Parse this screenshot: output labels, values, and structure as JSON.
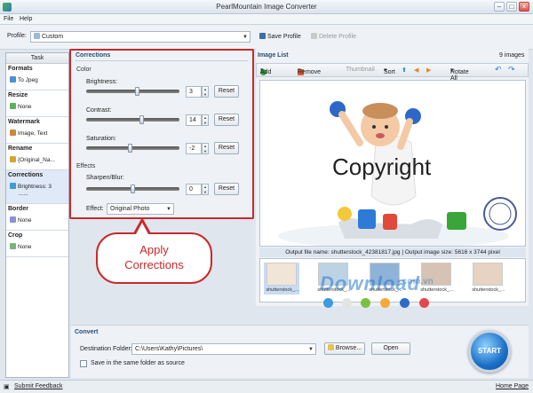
{
  "window": {
    "title": "PearlMountain Image Converter"
  },
  "menu": {
    "file": "File",
    "help": "Help"
  },
  "profile": {
    "label": "Profile:",
    "value": "Custom",
    "save": "Save Profile",
    "delete": "Delete Profile"
  },
  "task": {
    "header": "Task",
    "sections": [
      {
        "title": "Formats",
        "value": "To Jpeg"
      },
      {
        "title": "Resize",
        "value": "None"
      },
      {
        "title": "Watermark",
        "value": "Image, Text"
      },
      {
        "title": "Rename",
        "value": "{Original_Na..."
      },
      {
        "title": "Corrections",
        "value": "Brightness: 3",
        "value2": "......"
      },
      {
        "title": "Border",
        "value": "None"
      },
      {
        "title": "Crop",
        "value": "None"
      }
    ]
  },
  "corrections": {
    "header": "Corrections",
    "color_group": "Color",
    "brightness": {
      "label": "Brightness:",
      "value": "3",
      "reset": "Reset",
      "level": 0.55
    },
    "contrast": {
      "label": "Contrast:",
      "value": "14",
      "reset": "Reset",
      "level": 0.6
    },
    "saturation": {
      "label": "Saturation:",
      "value": "-2",
      "reset": "Reset",
      "level": 0.48
    },
    "effects_group": "Effects",
    "sharpen": {
      "label": "Sharpen/Blur:",
      "value": "0",
      "reset": "Reset",
      "level": 0.5
    },
    "effect": {
      "label": "Effect:",
      "value": "Original Photo"
    }
  },
  "callout": {
    "line1": "Apply",
    "line2": "Corrections"
  },
  "image_list": {
    "header": "Image List",
    "count": "9 images",
    "toolbar": {
      "add": "Add",
      "remove": "Remove",
      "thumbnail": "Thumbnail",
      "sort": "Sort",
      "rotate": "Rotate All"
    },
    "preview_text": "Copyright",
    "file_info": "Output file name: shutterstock_42381817.jpg | Output image size: 5616 x 3744 pixel",
    "thumbnails": [
      "shutterstock_...",
      "shutterstock_...",
      "shutterstock_...",
      "shutterstock_...",
      "shutterstock_..."
    ]
  },
  "watermark": {
    "text": "Download",
    "suffix": ".com.vn"
  },
  "convert": {
    "header": "Convert",
    "dest_label": "Destination Folder:",
    "dest_value": "C:\\Users\\Kathy\\Pictures\\",
    "browse": "Browse...",
    "open": "Open",
    "same_folder": "Save in the same folder as source",
    "start": "START"
  },
  "status": {
    "feedback": "Submit Feedback",
    "home": "Home Page"
  },
  "colors": {
    "accent": "#2b4a72",
    "highlight": "#c82a2a",
    "start": "#1a70c7"
  }
}
